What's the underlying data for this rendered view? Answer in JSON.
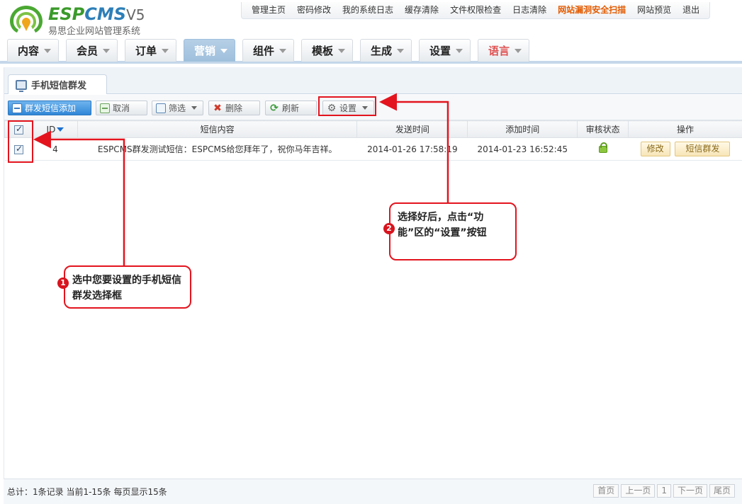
{
  "app": {
    "logo_text_a": "ESP",
    "logo_text_b": "CMS",
    "logo_version": "V5",
    "logo_subtitle": "易思企业网站管理系统"
  },
  "topnav": [
    {
      "label": "管理主页",
      "alert": false
    },
    {
      "label": "密码修改",
      "alert": false
    },
    {
      "label": "我的系统日志",
      "alert": false
    },
    {
      "label": "缓存清除",
      "alert": false
    },
    {
      "label": "文件权限检查",
      "alert": false
    },
    {
      "label": "日志清除",
      "alert": false
    },
    {
      "label": "网站漏洞安全扫描",
      "alert": true
    },
    {
      "label": "网站预览",
      "alert": false
    },
    {
      "label": "退出",
      "alert": false
    }
  ],
  "menu": [
    {
      "label": "内容"
    },
    {
      "label": "会员"
    },
    {
      "label": "订单"
    },
    {
      "label": "营销",
      "active": true
    },
    {
      "label": "组件"
    },
    {
      "label": "模板"
    },
    {
      "label": "生成"
    },
    {
      "label": "设置"
    },
    {
      "label": "语言",
      "lang": true
    }
  ],
  "tab": {
    "label": "手机短信群发"
  },
  "toolbar": {
    "add_label": "群发短信添加",
    "cancel_label": "取消",
    "filter_label": "筛选",
    "delete_label": "删除",
    "refresh_label": "刷新",
    "settings_label": "设置"
  },
  "table": {
    "headers": {
      "id": "ID",
      "content": "短信内容",
      "send_time": "发送时间",
      "add_time": "添加时间",
      "review": "审核状态",
      "ops": "操作"
    },
    "rows": [
      {
        "id": "4",
        "content": "ESPCMS群发测试短信：ESPCMS给您拜年了，祝你马年吉祥。",
        "send_time": "2014-01-26 17:58:19",
        "add_time": "2014-01-23 16:52:45",
        "edit_label": "修改",
        "send_label": "短信群发"
      }
    ]
  },
  "annotations": {
    "callout1_num": "1",
    "callout1_text": "选中您要设置的手机短信群发选择框",
    "callout2_num": "2",
    "callout2_text": "选择好后，点击“功能”区的“设置”按钮"
  },
  "footer": {
    "summary": "总计：1条记录 当前1-15条 每页显示15条",
    "first": "首页",
    "prev": "上一页",
    "page": "1",
    "next": "下一页",
    "last": "尾页"
  },
  "colors": {
    "accent": "#2f86d6",
    "annotation_red": "#e3141e",
    "menu_active": "#9fbfdc"
  }
}
